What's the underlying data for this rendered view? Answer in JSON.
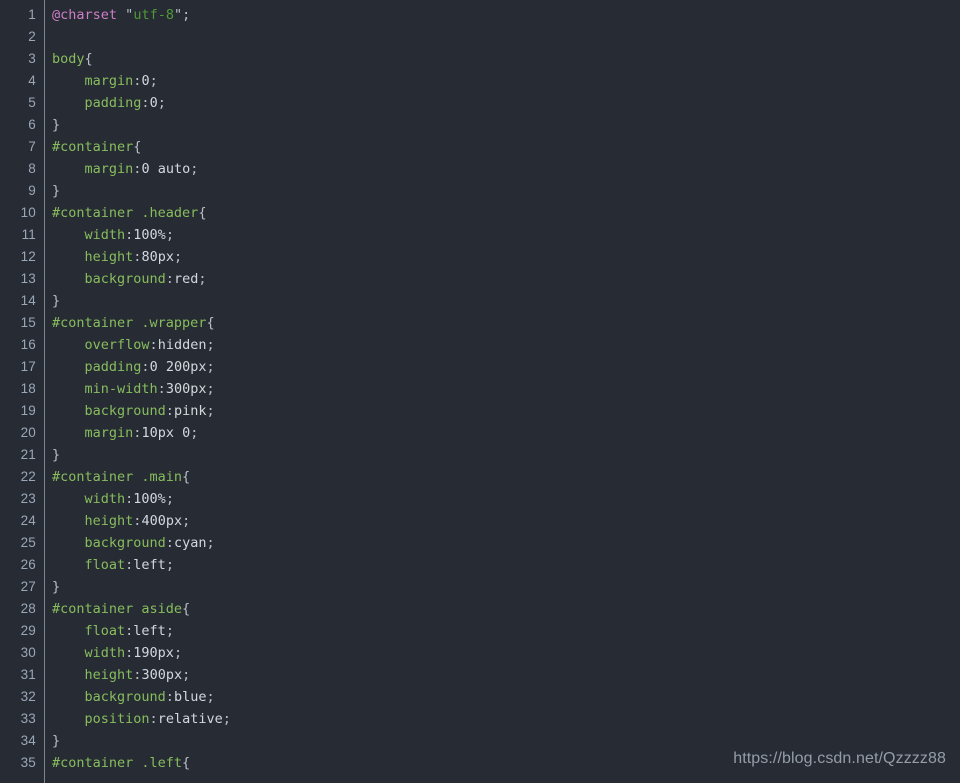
{
  "editor": {
    "language": "css",
    "background_color": "#272b33",
    "gutter": {
      "first_line": 1,
      "last_line": 35,
      "line_numbers": [
        1,
        2,
        3,
        4,
        5,
        6,
        7,
        8,
        9,
        10,
        11,
        12,
        13,
        14,
        15,
        16,
        17,
        18,
        19,
        20,
        21,
        22,
        23,
        24,
        25,
        26,
        27,
        28,
        29,
        30,
        31,
        32,
        33,
        34,
        35
      ]
    },
    "colors": {
      "selector": "#87bd5e",
      "property": "#87bd5e",
      "value": "#d3d7de",
      "punctuation": "#b9bfc9",
      "at_rule": "#cf7ec8",
      "string": "#4f9a38",
      "line_number": "#9aa7b8",
      "background": "#272b33"
    },
    "lines": [
      {
        "n": 1,
        "tokens": [
          {
            "t": "at",
            "v": "@charset"
          },
          {
            "t": "val",
            "v": " "
          },
          {
            "t": "quote",
            "v": "\""
          },
          {
            "t": "str",
            "v": "utf-8"
          },
          {
            "t": "quote",
            "v": "\""
          },
          {
            "t": "punct",
            "v": ";"
          }
        ]
      },
      {
        "n": 2,
        "tokens": []
      },
      {
        "n": 3,
        "tokens": [
          {
            "t": "sel",
            "v": "body"
          },
          {
            "t": "punct",
            "v": "{"
          }
        ]
      },
      {
        "n": 4,
        "tokens": [
          {
            "t": "val",
            "v": "    "
          },
          {
            "t": "prop",
            "v": "margin"
          },
          {
            "t": "punct",
            "v": ":"
          },
          {
            "t": "val",
            "v": "0"
          },
          {
            "t": "punct",
            "v": ";"
          }
        ]
      },
      {
        "n": 5,
        "tokens": [
          {
            "t": "val",
            "v": "    "
          },
          {
            "t": "prop",
            "v": "padding"
          },
          {
            "t": "punct",
            "v": ":"
          },
          {
            "t": "val",
            "v": "0"
          },
          {
            "t": "punct",
            "v": ";"
          }
        ]
      },
      {
        "n": 6,
        "tokens": [
          {
            "t": "punct",
            "v": "}"
          }
        ]
      },
      {
        "n": 7,
        "tokens": [
          {
            "t": "sel",
            "v": "#container"
          },
          {
            "t": "punct",
            "v": "{"
          }
        ]
      },
      {
        "n": 8,
        "tokens": [
          {
            "t": "val",
            "v": "    "
          },
          {
            "t": "prop",
            "v": "margin"
          },
          {
            "t": "punct",
            "v": ":"
          },
          {
            "t": "val",
            "v": "0 auto"
          },
          {
            "t": "punct",
            "v": ";"
          }
        ]
      },
      {
        "n": 9,
        "tokens": [
          {
            "t": "punct",
            "v": "}"
          }
        ]
      },
      {
        "n": 10,
        "tokens": [
          {
            "t": "sel",
            "v": "#container .header"
          },
          {
            "t": "punct",
            "v": "{"
          }
        ]
      },
      {
        "n": 11,
        "tokens": [
          {
            "t": "val",
            "v": "    "
          },
          {
            "t": "prop",
            "v": "width"
          },
          {
            "t": "punct",
            "v": ":"
          },
          {
            "t": "val",
            "v": "100%"
          },
          {
            "t": "punct",
            "v": ";"
          }
        ]
      },
      {
        "n": 12,
        "tokens": [
          {
            "t": "val",
            "v": "    "
          },
          {
            "t": "prop",
            "v": "height"
          },
          {
            "t": "punct",
            "v": ":"
          },
          {
            "t": "val",
            "v": "80px"
          },
          {
            "t": "punct",
            "v": ";"
          }
        ]
      },
      {
        "n": 13,
        "tokens": [
          {
            "t": "val",
            "v": "    "
          },
          {
            "t": "prop",
            "v": "background"
          },
          {
            "t": "punct",
            "v": ":"
          },
          {
            "t": "val",
            "v": "red"
          },
          {
            "t": "punct",
            "v": ";"
          }
        ]
      },
      {
        "n": 14,
        "tokens": [
          {
            "t": "punct",
            "v": "}"
          }
        ]
      },
      {
        "n": 15,
        "tokens": [
          {
            "t": "sel",
            "v": "#container .wrapper"
          },
          {
            "t": "punct",
            "v": "{"
          }
        ]
      },
      {
        "n": 16,
        "tokens": [
          {
            "t": "val",
            "v": "    "
          },
          {
            "t": "prop",
            "v": "overflow"
          },
          {
            "t": "punct",
            "v": ":"
          },
          {
            "t": "val",
            "v": "hidden"
          },
          {
            "t": "punct",
            "v": ";"
          }
        ]
      },
      {
        "n": 17,
        "tokens": [
          {
            "t": "val",
            "v": "    "
          },
          {
            "t": "prop",
            "v": "padding"
          },
          {
            "t": "punct",
            "v": ":"
          },
          {
            "t": "val",
            "v": "0 200px"
          },
          {
            "t": "punct",
            "v": ";"
          }
        ]
      },
      {
        "n": 18,
        "tokens": [
          {
            "t": "val",
            "v": "    "
          },
          {
            "t": "prop",
            "v": "min-width"
          },
          {
            "t": "punct",
            "v": ":"
          },
          {
            "t": "val",
            "v": "300px"
          },
          {
            "t": "punct",
            "v": ";"
          }
        ]
      },
      {
        "n": 19,
        "tokens": [
          {
            "t": "val",
            "v": "    "
          },
          {
            "t": "prop",
            "v": "background"
          },
          {
            "t": "punct",
            "v": ":"
          },
          {
            "t": "val",
            "v": "pink"
          },
          {
            "t": "punct",
            "v": ";"
          }
        ]
      },
      {
        "n": 20,
        "tokens": [
          {
            "t": "val",
            "v": "    "
          },
          {
            "t": "prop",
            "v": "margin"
          },
          {
            "t": "punct",
            "v": ":"
          },
          {
            "t": "val",
            "v": "10px 0"
          },
          {
            "t": "punct",
            "v": ";"
          }
        ]
      },
      {
        "n": 21,
        "tokens": [
          {
            "t": "punct",
            "v": "}"
          }
        ]
      },
      {
        "n": 22,
        "tokens": [
          {
            "t": "sel",
            "v": "#container .main"
          },
          {
            "t": "punct",
            "v": "{"
          }
        ]
      },
      {
        "n": 23,
        "tokens": [
          {
            "t": "val",
            "v": "    "
          },
          {
            "t": "prop",
            "v": "width"
          },
          {
            "t": "punct",
            "v": ":"
          },
          {
            "t": "val",
            "v": "100%"
          },
          {
            "t": "punct",
            "v": ";"
          }
        ]
      },
      {
        "n": 24,
        "tokens": [
          {
            "t": "val",
            "v": "    "
          },
          {
            "t": "prop",
            "v": "height"
          },
          {
            "t": "punct",
            "v": ":"
          },
          {
            "t": "val",
            "v": "400px"
          },
          {
            "t": "punct",
            "v": ";"
          }
        ]
      },
      {
        "n": 25,
        "tokens": [
          {
            "t": "val",
            "v": "    "
          },
          {
            "t": "prop",
            "v": "background"
          },
          {
            "t": "punct",
            "v": ":"
          },
          {
            "t": "val",
            "v": "cyan"
          },
          {
            "t": "punct",
            "v": ";"
          }
        ]
      },
      {
        "n": 26,
        "tokens": [
          {
            "t": "val",
            "v": "    "
          },
          {
            "t": "prop",
            "v": "float"
          },
          {
            "t": "punct",
            "v": ":"
          },
          {
            "t": "val",
            "v": "left"
          },
          {
            "t": "punct",
            "v": ";"
          }
        ]
      },
      {
        "n": 27,
        "tokens": [
          {
            "t": "punct",
            "v": "}"
          }
        ]
      },
      {
        "n": 28,
        "tokens": [
          {
            "t": "sel",
            "v": "#container aside"
          },
          {
            "t": "punct",
            "v": "{"
          }
        ]
      },
      {
        "n": 29,
        "tokens": [
          {
            "t": "val",
            "v": "    "
          },
          {
            "t": "prop",
            "v": "float"
          },
          {
            "t": "punct",
            "v": ":"
          },
          {
            "t": "val",
            "v": "left"
          },
          {
            "t": "punct",
            "v": ";"
          }
        ]
      },
      {
        "n": 30,
        "tokens": [
          {
            "t": "val",
            "v": "    "
          },
          {
            "t": "prop",
            "v": "width"
          },
          {
            "t": "punct",
            "v": ":"
          },
          {
            "t": "val",
            "v": "190px"
          },
          {
            "t": "punct",
            "v": ";"
          }
        ]
      },
      {
        "n": 31,
        "tokens": [
          {
            "t": "val",
            "v": "    "
          },
          {
            "t": "prop",
            "v": "height"
          },
          {
            "t": "punct",
            "v": ":"
          },
          {
            "t": "val",
            "v": "300px"
          },
          {
            "t": "punct",
            "v": ";"
          }
        ]
      },
      {
        "n": 32,
        "tokens": [
          {
            "t": "val",
            "v": "    "
          },
          {
            "t": "prop",
            "v": "background"
          },
          {
            "t": "punct",
            "v": ":"
          },
          {
            "t": "val",
            "v": "blue"
          },
          {
            "t": "punct",
            "v": ";"
          }
        ]
      },
      {
        "n": 33,
        "tokens": [
          {
            "t": "val",
            "v": "    "
          },
          {
            "t": "prop",
            "v": "position"
          },
          {
            "t": "punct",
            "v": ":"
          },
          {
            "t": "val",
            "v": "relative"
          },
          {
            "t": "punct",
            "v": ";"
          }
        ]
      },
      {
        "n": 34,
        "tokens": [
          {
            "t": "punct",
            "v": "}"
          }
        ]
      },
      {
        "n": 35,
        "tokens": [
          {
            "t": "sel",
            "v": "#container .left"
          },
          {
            "t": "punct",
            "v": "{"
          }
        ]
      }
    ]
  },
  "watermark": {
    "text": "https://blog.csdn.net/Qzzzz88"
  }
}
